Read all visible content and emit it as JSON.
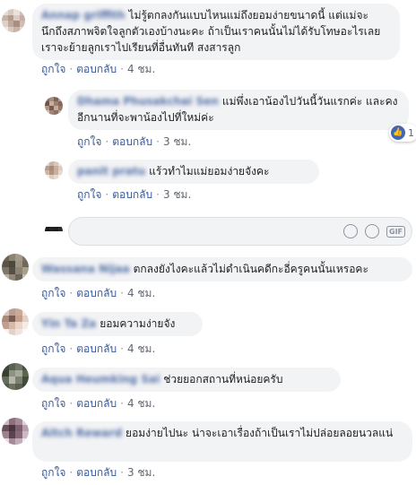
{
  "comments": [
    {
      "name": "Annap griffith",
      "text": "ไม่รู้ตกลงกันแบบไหนแม่ถึงยอมง่ายขนาดนี้ แต่แม่จะนึกถึงสภาพจิตใจลูกตัวเองบ้างนะคะ ถ้าเป็นเราคนนั้นไม่ได้รับโทษอะไรเลย เราจะย้ายลูกเราไปเรียนที่อื่นทันที สงสารลูก",
      "like": "ถูกใจ",
      "reply": "ตอบกลับ",
      "time": "4 ชม."
    },
    {
      "name": "Dhama Phusakchai Sen",
      "text": "แม่พึ่งเอาน้องไปวันนี้วันแรกค่ะ และคงอีกนานที่จะพาน้องไปที่ใหม่ค่ะ",
      "like": "ถูกใจ",
      "reply": "ตอบกลับ",
      "time": "3 ชม.",
      "reaction_count": "1"
    },
    {
      "name": "panit pratu",
      "text": "แร้วทำไมแม่ยอมง่ายจังคะ",
      "like": "ถูกใจ",
      "reply": "ตอบกลับ",
      "time": "3 ชม."
    },
    {
      "name": "Wassana Nijaa",
      "text": "ตกลงยังไงคะแล้วไม่ดำเนินคดีกะอี่ครูคนนั้นเหรอคะ",
      "like": "ถูกใจ",
      "reply": "ตอบกลับ",
      "time": "4 ชม."
    },
    {
      "name": "Yin Ta Za",
      "text": "ยอมความง่ายจัง",
      "like": "ถูกใจ",
      "reply": "ตอบกลับ",
      "time": "4 ชม."
    },
    {
      "name": "Aqua Heumking Sai",
      "text": "ช่วยยอกสถานที่หน่อยครับ",
      "like": "ถูกใจ",
      "reply": "ตอบกลับ",
      "time": "4 ชม."
    },
    {
      "name": "Aitch Reward",
      "text": "ยอมง่ายไปนะ น่าจะเอาเรื่องถ้าเป็นเราไม่ปล่อยลอยนวลแน่",
      "like": "ถูกใจ",
      "reply": "ตอบกลับ",
      "time": "3 ชม."
    }
  ],
  "reply_box": {
    "placeholder": "",
    "gif_label": "GIF"
  },
  "colors": {
    "link": "#385898",
    "name": "#365899",
    "bubble": "#f2f3f5",
    "like_blue": "#4267b2"
  }
}
